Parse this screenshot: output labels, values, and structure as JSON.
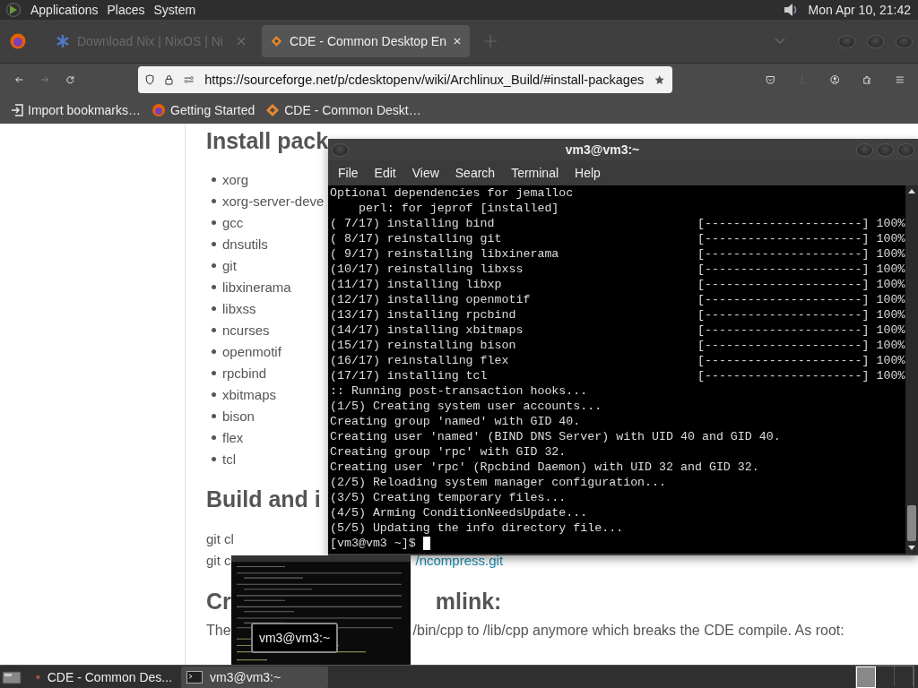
{
  "top_panel": {
    "menus": [
      "Applications",
      "Places",
      "System"
    ],
    "clock": "Mon Apr 10, 21:42"
  },
  "browser": {
    "tabs": [
      {
        "title": "Download Nix | NixOS | Ni",
        "selected": false
      },
      {
        "title": "CDE - Common Desktop En",
        "selected": true
      }
    ],
    "url": "https://sourceforge.net/p/cdesktopenv/wiki/Archlinux_Build/#install-packages",
    "bookmarks": [
      {
        "label": "Import bookmarks…"
      },
      {
        "label": "Getting Started"
      },
      {
        "label": "CDE - Common Deskt…"
      }
    ],
    "page": {
      "heading_1": "Install pack",
      "packages": [
        "xorg",
        "xorg-server-deve",
        "gcc",
        "dnsutils",
        "git",
        "libxinerama",
        "libxss",
        "ncurses",
        "openmotif",
        "rpcbind",
        "xbitmaps",
        "bison",
        "flex",
        "tcl"
      ],
      "heading_2": "Build and i",
      "clone_lines": [
        {
          "text": "git cl"
        },
        {
          "text": "git c",
          "link": "/ncompress.git"
        }
      ],
      "heading_3": {
        "start": "Cr",
        "end": "mlink:"
      },
      "paragraph": {
        "start": "The",
        "end": "/bin/cpp to /lib/cpp anymore which breaks the CDE compile. As root:"
      }
    }
  },
  "terminal": {
    "title": "vm3@vm3:~",
    "menus": [
      "File",
      "Edit",
      "View",
      "Search",
      "Terminal",
      "Help"
    ],
    "lines": [
      {
        "kind": "text",
        "text": "Optional dependencies for jemalloc"
      },
      {
        "kind": "text",
        "text": "    perl: for jeprof [installed]"
      },
      {
        "kind": "progress",
        "text": "( 7/17) installing bind",
        "bar": "[----------------------]",
        "percent": "100%"
      },
      {
        "kind": "progress",
        "text": "( 8/17) reinstalling git",
        "bar": "[----------------------]",
        "percent": "100%"
      },
      {
        "kind": "progress",
        "text": "( 9/17) reinstalling libxinerama",
        "bar": "[----------------------]",
        "percent": "100%"
      },
      {
        "kind": "progress",
        "text": "(10/17) reinstalling libxss",
        "bar": "[----------------------]",
        "percent": "100%"
      },
      {
        "kind": "progress",
        "text": "(11/17) installing libxp",
        "bar": "[----------------------]",
        "percent": "100%"
      },
      {
        "kind": "progress",
        "text": "(12/17) installing openmotif",
        "bar": "[----------------------]",
        "percent": "100%"
      },
      {
        "kind": "progress",
        "text": "(13/17) installing rpcbind",
        "bar": "[----------------------]",
        "percent": "100%"
      },
      {
        "kind": "progress",
        "text": "(14/17) installing xbitmaps",
        "bar": "[----------------------]",
        "percent": "100%"
      },
      {
        "kind": "progress",
        "text": "(15/17) reinstalling bison",
        "bar": "[----------------------]",
        "percent": "100%"
      },
      {
        "kind": "progress",
        "text": "(16/17) reinstalling flex",
        "bar": "[----------------------]",
        "percent": "100%"
      },
      {
        "kind": "progress",
        "text": "(17/17) installing tcl",
        "bar": "[----------------------]",
        "percent": "100%"
      },
      {
        "kind": "text",
        "text": ":: Running post-transaction hooks..."
      },
      {
        "kind": "text",
        "text": "(1/5) Creating system user accounts..."
      },
      {
        "kind": "text",
        "text": "Creating group 'named' with GID 40."
      },
      {
        "kind": "text",
        "text": "Creating user 'named' (BIND DNS Server) with UID 40 and GID 40."
      },
      {
        "kind": "text",
        "text": "Creating group 'rpc' with GID 32."
      },
      {
        "kind": "text",
        "text": "Creating user 'rpc' (Rpcbind Daemon) with UID 32 and GID 32."
      },
      {
        "kind": "text",
        "text": "(2/5) Reloading system manager configuration..."
      },
      {
        "kind": "text",
        "text": "(3/5) Creating temporary files..."
      },
      {
        "kind": "text",
        "text": "(4/5) Arming ConditionNeedsUpdate..."
      },
      {
        "kind": "text",
        "text": "(5/5) Updating the info directory file..."
      },
      {
        "kind": "prompt",
        "text": "[vm3@vm3 ~]$"
      }
    ]
  },
  "switcher": {
    "label": "vm3@vm3:~"
  },
  "taskbar": {
    "items": [
      {
        "label": "CDE - Common Des...",
        "selected": false
      },
      {
        "label": "vm3@vm3:~",
        "selected": true
      }
    ]
  }
}
